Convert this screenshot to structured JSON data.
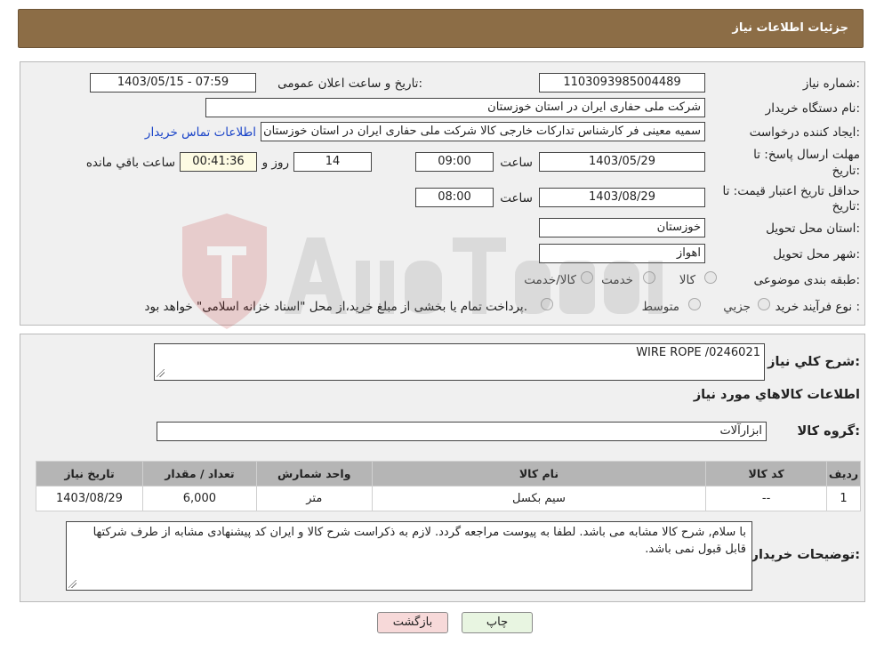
{
  "header": {
    "title": "جزئیات اطلاعات نیاز"
  },
  "info": {
    "need_number_label": "شماره نیاز:",
    "need_number": "1103093985004489",
    "announce_label": "تاریخ و ساعت اعلان عمومی:",
    "announce_value": "1403/05/15 - 07:59",
    "buyer_label": "نام دستگاه خریدار:",
    "buyer_value": "شرکت ملی حفاری ایران در استان خوزستان",
    "creator_label": "ایجاد کننده درخواست:",
    "creator_value": "سمیه معینی فر کارشناس تدارکات خارجی کالا شرکت ملی حفاری ایران در استان خوزستان",
    "contact_link": "اطلاعات تماس خریدار",
    "deadline_label_1": "مهلت ارسال پاسخ: تا",
    "deadline_label_2": "تاریخ:",
    "deadline_date": "1403/05/29",
    "time_label": "ساعت",
    "deadline_time": "09:00",
    "days_value": "14",
    "days_suffix": "روز و",
    "remaining_time": "00:41:36",
    "remaining_suffix": "ساعت باقي مانده",
    "validity_label_1": "حداقل تاریخ اعتبار قیمت: تا",
    "validity_label_2": "تاریخ:",
    "validity_date": "1403/08/29",
    "validity_time": "08:00",
    "province_label": "استان محل تحویل:",
    "province_value": "خوزستان",
    "city_label": "شهر محل تحویل:",
    "city_value": "اهواز",
    "category_label": "طبقه بندی موضوعی:",
    "category_options": [
      "کالا",
      "خدمت",
      "کالا/خدمت"
    ],
    "process_label": "نوع فرآیند خرید :",
    "process_options": [
      "جزیي",
      "متوسط"
    ],
    "process_note": "پرداخت تمام یا بخشی از مبلغ خرید،از محل \"اسناد خزانه اسلامی\" خواهد بود."
  },
  "details": {
    "summary_label": "شرح کلي نياز:",
    "summary_value": "WIRE ROPE /0246021",
    "goods_title": "اطلاعات کالاهاي مورد نياز",
    "group_label": "گروه کالا:",
    "group_value": "ابزارآلات",
    "table": {
      "headers": [
        "رديف",
        "کد کالا",
        "نام کالا",
        "واحد شمارش",
        "تعداد / مقدار",
        "تاریخ نیاز"
      ],
      "rows": [
        [
          "1",
          "--",
          "سیم بکسل",
          "متر",
          "6,000",
          "1403/08/29"
        ]
      ]
    },
    "notes_label": "توضیحات خریدار:",
    "notes_value": "با سلام, شرح کالا مشابه می باشد. لطفا به پیوست مراجعه گردد. لازم به ذکراست شرح کالا و ایران کد  پیشنهادی مشابه از طرف شرکتها قابل قبول نمی باشد."
  },
  "buttons": {
    "print": "چاپ",
    "back": "بازگشت"
  },
  "colors": {
    "header": "#8c6d46",
    "back_button": "#f7d9d9",
    "print_button": "#e8f5e1"
  }
}
